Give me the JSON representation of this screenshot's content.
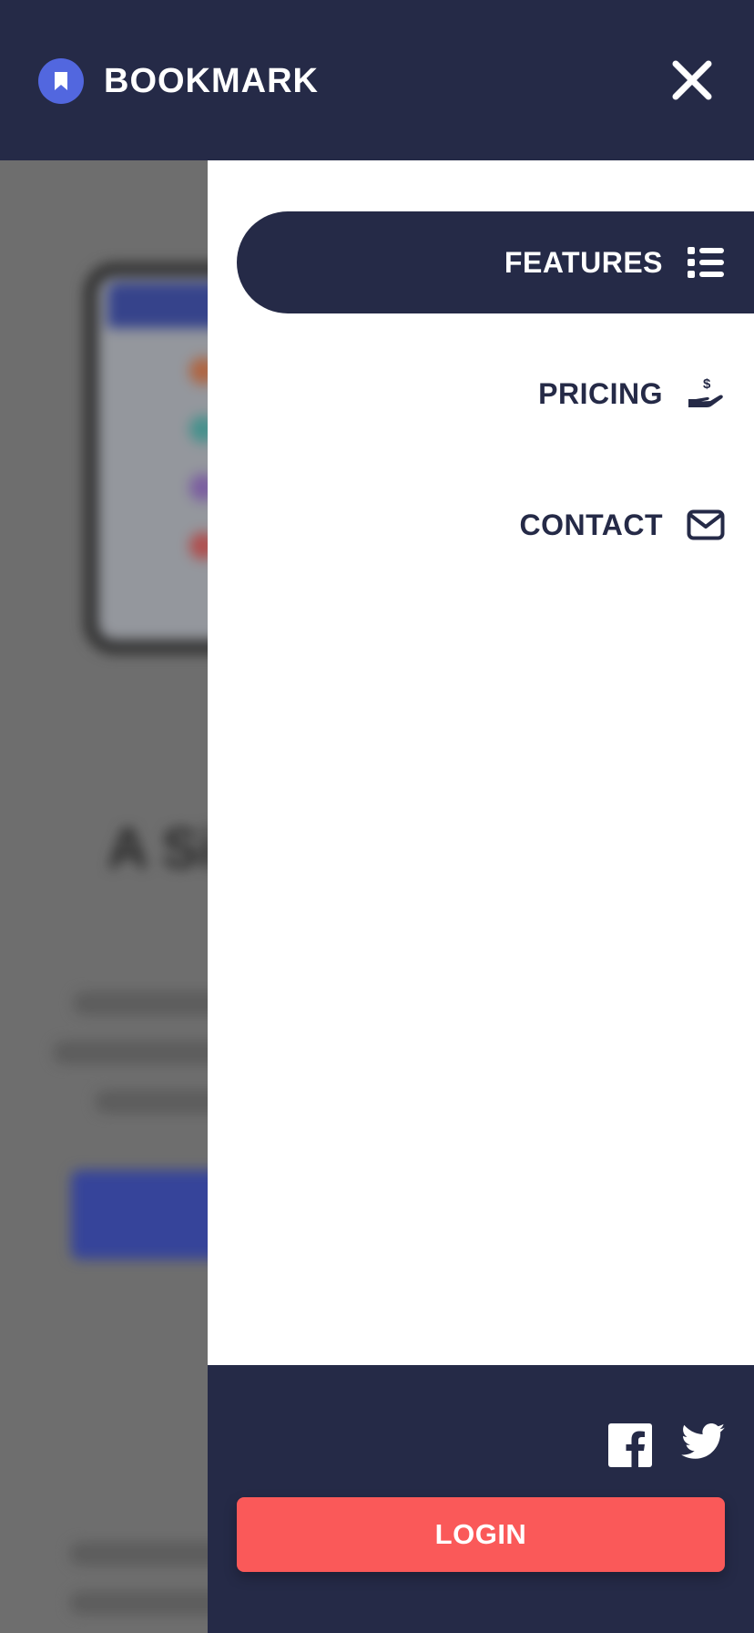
{
  "brand": {
    "name": "BOOKMARK"
  },
  "menu": {
    "items": [
      {
        "label": "FEATURES",
        "icon": "list-icon",
        "active": true
      },
      {
        "label": "PRICING",
        "icon": "hand-dollar-icon",
        "active": false
      },
      {
        "label": "CONTACT",
        "icon": "envelope-icon",
        "active": false
      }
    ]
  },
  "footer": {
    "social": [
      "facebook-icon",
      "twitter-icon"
    ],
    "login_label": "LOGIN"
  },
  "colors": {
    "navy": "#252a47",
    "accent_blue": "#5267df",
    "login_red": "#fa5959",
    "white": "#ffffff"
  }
}
